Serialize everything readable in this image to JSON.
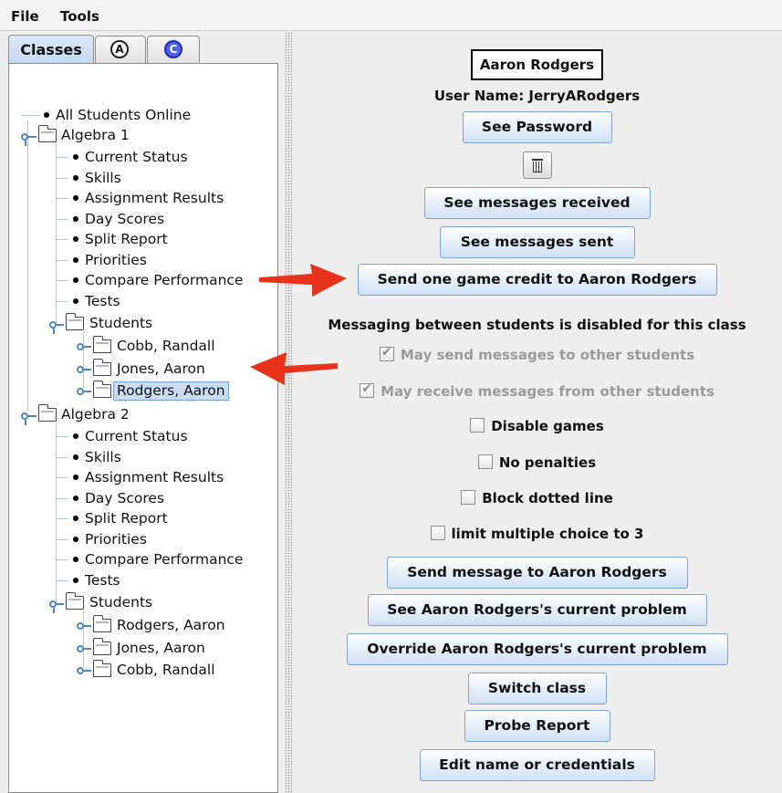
{
  "menubar": {
    "file": "File",
    "tools": "Tools"
  },
  "tabs": {
    "classes": "Classes",
    "a_icon": "A",
    "c_icon": "C"
  },
  "tree": {
    "root_all": "All Students Online",
    "classes": [
      {
        "name": "Algebra 1",
        "reports": [
          "Current Status",
          "Skills",
          "Assignment Results",
          "Day Scores",
          "Split Report",
          "Priorities",
          "Compare Performance",
          "Tests"
        ],
        "students_label": "Students",
        "students": [
          "Cobb, Randall",
          "Jones, Aaron",
          "Rodgers, Aaron"
        ]
      },
      {
        "name": "Algebra 2",
        "reports": [
          "Current Status",
          "Skills",
          "Assignment Results",
          "Day Scores",
          "Split Report",
          "Priorities",
          "Compare Performance",
          "Tests"
        ],
        "students_label": "Students",
        "students": [
          "Rodgers, Aaron",
          "Jones, Aaron",
          "Cobb, Randall"
        ]
      }
    ],
    "selected_student": "Rodgers, Aaron"
  },
  "detail": {
    "student_name": "Aaron Rodgers",
    "username_line": "User Name: JerryARodgers",
    "buttons": {
      "see_password": "See Password",
      "see_received": "See messages received",
      "see_sent": "See messages sent",
      "send_credit": "Send one game credit to Aaron Rodgers",
      "send_message": "Send message to Aaron Rodgers",
      "see_problem": "See Aaron Rodgers's current problem",
      "override_problem": "Override Aaron Rodgers's current problem",
      "switch_class": "Switch class",
      "probe_report": "Probe Report",
      "edit_name": "Edit name or credentials"
    },
    "messaging_note": "Messaging between students is disabled for this class",
    "checkboxes": {
      "may_send": {
        "label": "May send messages to other students",
        "checked": true,
        "enabled": false
      },
      "may_receive": {
        "label": "May receive messages from other students",
        "checked": true,
        "enabled": false
      },
      "disable_games": {
        "label": "Disable games",
        "checked": false,
        "enabled": true
      },
      "no_penalties": {
        "label": "No penalties",
        "checked": false,
        "enabled": true
      },
      "block_dotted": {
        "label": "Block dotted line",
        "checked": false,
        "enabled": true
      },
      "limit_mc": {
        "label": "limit multiple choice to 3",
        "checked": false,
        "enabled": true
      }
    },
    "icons": {
      "delete": "trash-icon"
    }
  },
  "colors": {
    "selection": "#c9dcf3",
    "button_border": "#7fa3cf",
    "arrow": "#e8321b"
  }
}
